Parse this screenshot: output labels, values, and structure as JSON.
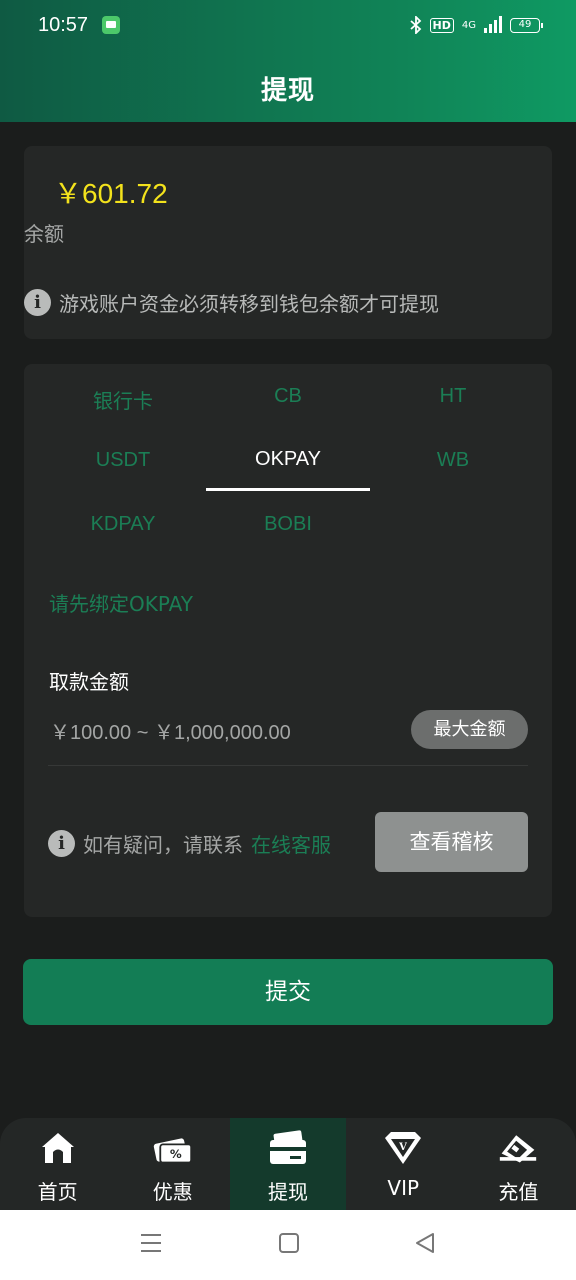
{
  "status_bar": {
    "time": "10:57",
    "network": "4G",
    "hd": "HD",
    "battery": "49"
  },
  "page": {
    "title": "提现"
  },
  "balance": {
    "amount": "￥601.72",
    "label": "余额",
    "notice": "游戏账户资金必须转移到钱包余额才可提现"
  },
  "methods": {
    "items": [
      "银行卡",
      "CB",
      "HT",
      "USDT",
      "OKPAY",
      "WB",
      "KDPAY",
      "BOBI"
    ],
    "active": "OKPAY"
  },
  "form": {
    "bind_hint": "请先绑定OKPAY",
    "amount_label": "取款金额",
    "amount_range": "￥100.00 ~ ￥1,000,000.00",
    "max_button": "最大金额",
    "contact_prefix": "如有疑问，请联系",
    "contact_link": "在线客服",
    "audit_button": "查看稽核",
    "submit_button": "提交"
  },
  "tabbar": {
    "items": [
      {
        "label": "首页",
        "icon": "home-icon"
      },
      {
        "label": "优惠",
        "icon": "promotion-ticket-icon"
      },
      {
        "label": "提现",
        "icon": "wallet-card-icon"
      },
      {
        "label": "VIP",
        "icon": "vip-diamond-icon"
      },
      {
        "label": "充值",
        "icon": "deposit-card-icon"
      }
    ],
    "active": "提现"
  },
  "colors": {
    "accent_green": "#137d55",
    "method_green": "#1b7e55",
    "balance_yellow": "#f3e21c",
    "background": "#1b1d1c",
    "card": "#252726"
  }
}
